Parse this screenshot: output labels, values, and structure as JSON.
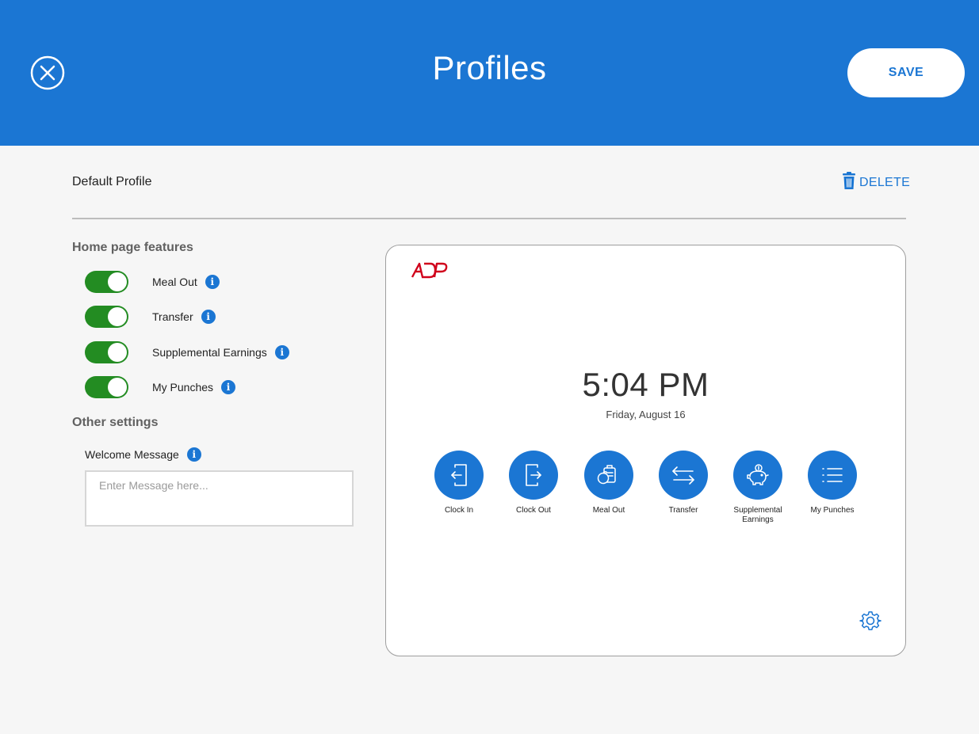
{
  "header": {
    "title": "Profiles",
    "save_label": "SAVE",
    "close_icon": "close-icon"
  },
  "profile": {
    "name": "Default Profile",
    "delete_label": "DELETE"
  },
  "home_features": {
    "heading": "Home page features",
    "items": [
      {
        "label": "Meal Out",
        "enabled": true
      },
      {
        "label": "Transfer",
        "enabled": true
      },
      {
        "label": "Supplemental Earnings",
        "enabled": true
      },
      {
        "label": "My Punches",
        "enabled": true
      }
    ]
  },
  "other_settings": {
    "heading": "Other settings",
    "welcome_label": "Welcome Message",
    "welcome_placeholder": "Enter Message here...",
    "welcome_value": ""
  },
  "preview": {
    "logo": "ADP",
    "time": "5:04 PM",
    "date": "Friday, August 16",
    "actions": [
      {
        "label": "Clock In",
        "icon": "clock-in-icon"
      },
      {
        "label": "Clock Out",
        "icon": "clock-out-icon"
      },
      {
        "label": "Meal Out",
        "icon": "meal-out-icon"
      },
      {
        "label": "Transfer",
        "icon": "transfer-icon"
      },
      {
        "label": "Supplemental Earnings",
        "icon": "piggy-bank-icon"
      },
      {
        "label": "My Punches",
        "icon": "list-icon"
      }
    ],
    "settings_icon": "gear-icon"
  },
  "colors": {
    "primary": "#1b76d3",
    "toggle_on": "#238c22",
    "brand_red": "#d0021b"
  }
}
